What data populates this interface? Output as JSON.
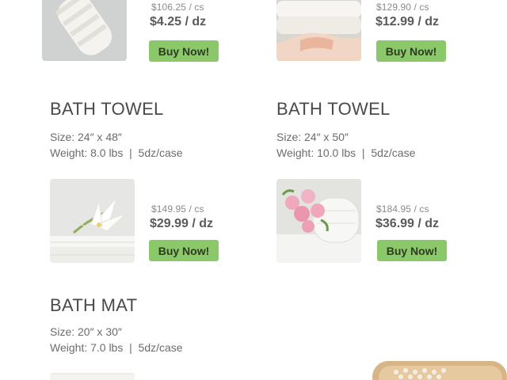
{
  "products": [
    {
      "title": "",
      "size": "",
      "weight": "",
      "price_cs": "$106.25 / cs",
      "price_dz": "$4.25 / dz",
      "button": "Buy Now!"
    },
    {
      "title": "",
      "size": "",
      "weight": "",
      "price_cs": "$129.90 / cs",
      "price_dz": "$12.99 / dz",
      "button": "Buy Now!"
    },
    {
      "title": "BATH TOWEL",
      "size": "Size: 24″ x 48″",
      "weight": "Weight: 8.0 lbs  |  5dz/case",
      "price_cs": "$149.95 / cs",
      "price_dz": "$29.99 / dz",
      "button": "Buy Now!"
    },
    {
      "title": "BATH TOWEL",
      "size": "Size: 24″ x 50″",
      "weight": "Weight: 10.0 lbs  |  5dz/case",
      "price_cs": "$184.95 / cs",
      "price_dz": "$36.99 / dz",
      "button": "Buy Now!"
    },
    {
      "title": "BATH MAT",
      "size": "Size: 20″ x 30″",
      "weight": "Weight: 7.0 lbs  |  5dz/case"
    }
  ],
  "colors": {
    "button": "#8bc86a",
    "title": "#4a4a4a",
    "text": "#6c6c6c"
  }
}
